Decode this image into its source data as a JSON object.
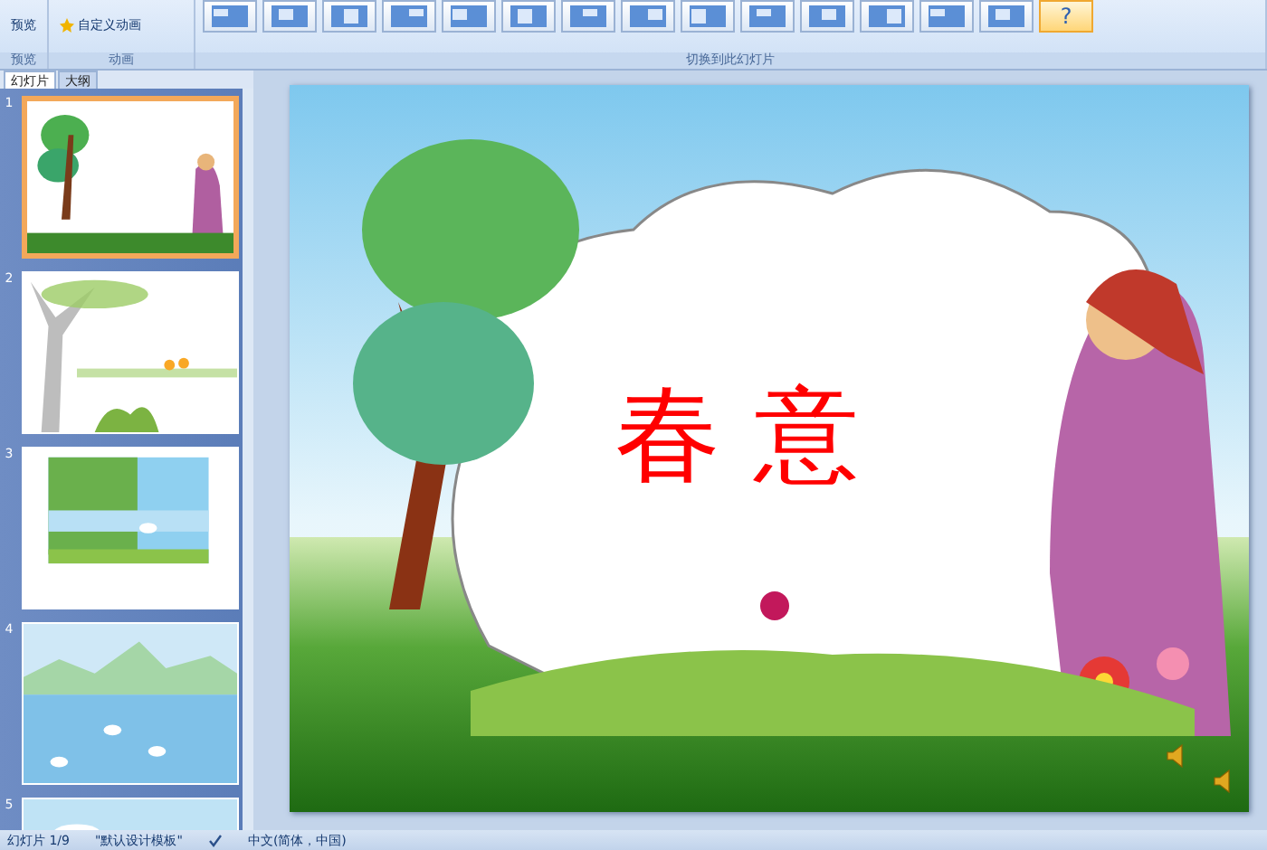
{
  "ribbon": {
    "preview_button": "预览",
    "custom_animation_button": "自定义动画",
    "groups": [
      "预览",
      "动画",
      "切换到此幻灯片"
    ],
    "transitions": [
      {
        "kind": "shape",
        "selected": false
      },
      {
        "kind": "shape",
        "selected": false
      },
      {
        "kind": "shape",
        "selected": false
      },
      {
        "kind": "shape",
        "selected": false
      },
      {
        "kind": "shape",
        "selected": false
      },
      {
        "kind": "shape",
        "selected": false
      },
      {
        "kind": "shape",
        "selected": false
      },
      {
        "kind": "shape",
        "selected": false
      },
      {
        "kind": "shape",
        "selected": false
      },
      {
        "kind": "shape",
        "selected": false
      },
      {
        "kind": "shape",
        "selected": false
      },
      {
        "kind": "shape",
        "selected": false
      },
      {
        "kind": "shape",
        "selected": false
      },
      {
        "kind": "shape",
        "selected": false
      },
      {
        "kind": "glyph",
        "label": "?",
        "selected": true
      }
    ]
  },
  "panel_tabs": [
    {
      "label": "幻灯片",
      "selected": true
    },
    {
      "label": "大纲",
      "selected": false
    }
  ],
  "thumbnails": [
    {
      "number": "1",
      "kind": "title",
      "selected": true
    },
    {
      "number": "2",
      "kind": "tree",
      "selected": false
    },
    {
      "number": "3",
      "kind": "lake",
      "selected": false
    },
    {
      "number": "4",
      "kind": "mountains",
      "selected": false
    },
    {
      "number": "5",
      "kind": "sky",
      "selected": false
    }
  ],
  "slide": {
    "title": "春 意"
  },
  "status_bar": {
    "slide_counter": "幻灯片 1/9",
    "theme": "\"默认设计模板\"",
    "language": "中文(简体，中国)"
  }
}
